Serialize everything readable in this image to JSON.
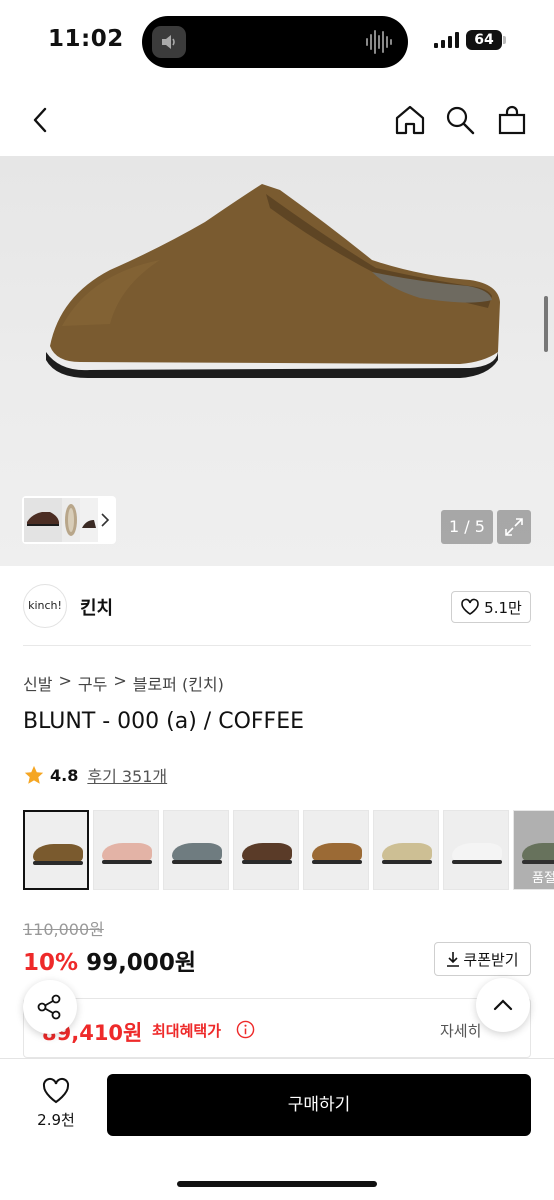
{
  "status": {
    "time": "11:02",
    "battery": "64"
  },
  "product": {
    "image_counter": "1 / 5",
    "brand_logo_text": "kinch!",
    "brand_name": "킨치",
    "likes": "5.1만",
    "breadcrumb": [
      "신발",
      ">",
      "구두",
      ">",
      "블로퍼 (킨치)"
    ],
    "title": "BLUNT - 000 (a) / COFFEE",
    "rating": "4.8",
    "review_link": "후기 351개",
    "swatch_more_label": "품절",
    "original_price": "110,000원",
    "discount": "10%",
    "sale_price": "99,000원",
    "coupon_label": "쿠폰받기",
    "benefit_price": "89,410원",
    "benefit_label": "최대혜택가",
    "detail_link": "자세히"
  },
  "swatch_colors": [
    "#7a5a2e",
    "#e3b3a6",
    "#6f7c80",
    "#5a3b28",
    "#9b6a35",
    "#cdbf94",
    "#f4f4f4",
    "#7f8f6e"
  ],
  "bottom_bar": {
    "wish_count": "2.9천",
    "buy_label": "구매하기"
  },
  "colors": {
    "accent_red": "#ee2a2a",
    "buy_button": "#000000"
  }
}
